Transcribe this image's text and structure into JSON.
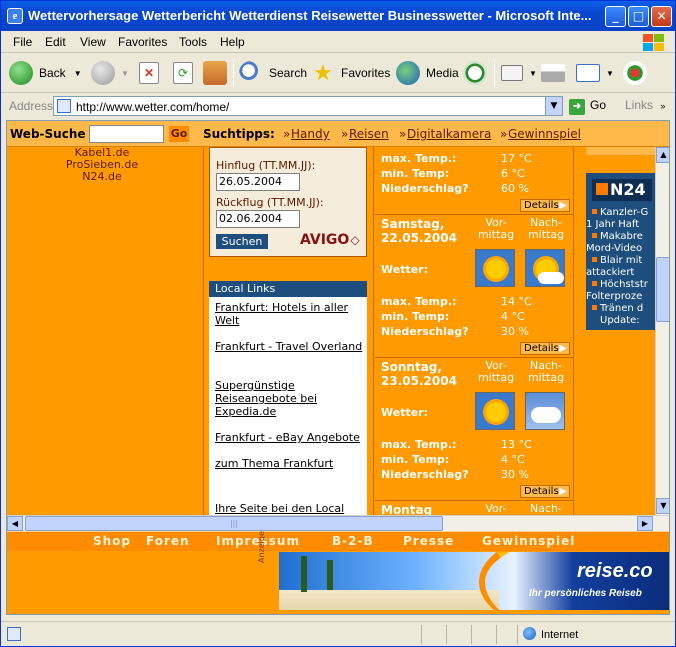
{
  "window": {
    "title": "Wettervorhersage Wetterbericht Wetterdienst Reisewetter Businesswetter - Microsoft Inte...",
    "controls": {
      "minimize": "_",
      "maximize": "□",
      "close": "✕"
    }
  },
  "menu": [
    "File",
    "Edit",
    "View",
    "Favorites",
    "Tools",
    "Help"
  ],
  "toolbar": {
    "back": "Back",
    "search": "Search",
    "favorites": "Favorites",
    "media": "Media"
  },
  "address": {
    "label": "Address",
    "url": "http://www.wetter.com/home/",
    "go": "Go",
    "links": "Links"
  },
  "search_strip": {
    "label": "Web-Suche",
    "go": "Go",
    "tips_label": "Suchtipps:",
    "tips": [
      "Handy",
      "Reisen",
      "Digitalkamera",
      "Gewinnspiel"
    ]
  },
  "left_links": [
    "Kabel1.de",
    "ProSieben.de",
    "N24.de"
  ],
  "booking_form": {
    "depart_label": "Hinflug (TT.MM.JJ):",
    "depart_value": "26.05.2004",
    "return_label": "Rückflug (TT.MM.JJ):",
    "return_value": "02.06.2004",
    "search_button": "Suchen",
    "brand": "AVIGO"
  },
  "local_links": {
    "header": "Local Links",
    "items": [
      "Frankfurt: Hotels in aller Welt",
      "Frankfurt - Travel Overland",
      "Supergünstige Reiseangebote bei Expedia.de",
      "Frankfurt - eBay Angebote",
      "zum Thema Frankfurt",
      "Ihre Seite bei den Local"
    ]
  },
  "weather": {
    "labels": {
      "max": "max. Temp.:",
      "min": "min. Temp:",
      "rain": "Niederschlag?",
      "weather": "Wetter:",
      "morning": "Vor-\nmittag",
      "afternoon": "Nach-\nmittag",
      "details": "Details"
    },
    "top": {
      "max": "17 °C",
      "min": "6 °C",
      "rain": "60 %"
    },
    "days": [
      {
        "name": "Samstag,",
        "date": "22.05.2004",
        "max": "14 °C",
        "min": "4 °C",
        "rain": "30 %",
        "icons": [
          "sun-icon",
          "sun-cloud-icon"
        ]
      },
      {
        "name": "Sonntag,",
        "date": "23.05.2004",
        "max": "13 °C",
        "min": "4 °C",
        "rain": "30 %",
        "icons": [
          "sun-icon",
          "cloud-icon"
        ]
      },
      {
        "name": "Montag",
        "date": "",
        "max": "",
        "min": "",
        "rain": "",
        "icons": []
      }
    ]
  },
  "n24": {
    "logo": "N24",
    "items": [
      "Kanzler-G",
      "1 Jahr Haft",
      "Makabre",
      "Mord-Video",
      "Blair mit",
      "attackiert",
      "Höchststr",
      "Folterproze",
      "Tränen d",
      "Update:"
    ]
  },
  "bottom_nav": [
    "Shop",
    "Foren",
    "Impressum",
    "B-2-B",
    "Presse",
    "Gewinnspiel"
  ],
  "ad": {
    "label": "Anzeige",
    "brand": "reise.co",
    "slogan": "Ihr persönliches Reiseb"
  },
  "status": {
    "zone": "Internet"
  },
  "colors": {
    "page_bg": "#ff9a00",
    "accent_blue": "#1d4e7d",
    "title_blue": "#0a46d0"
  }
}
